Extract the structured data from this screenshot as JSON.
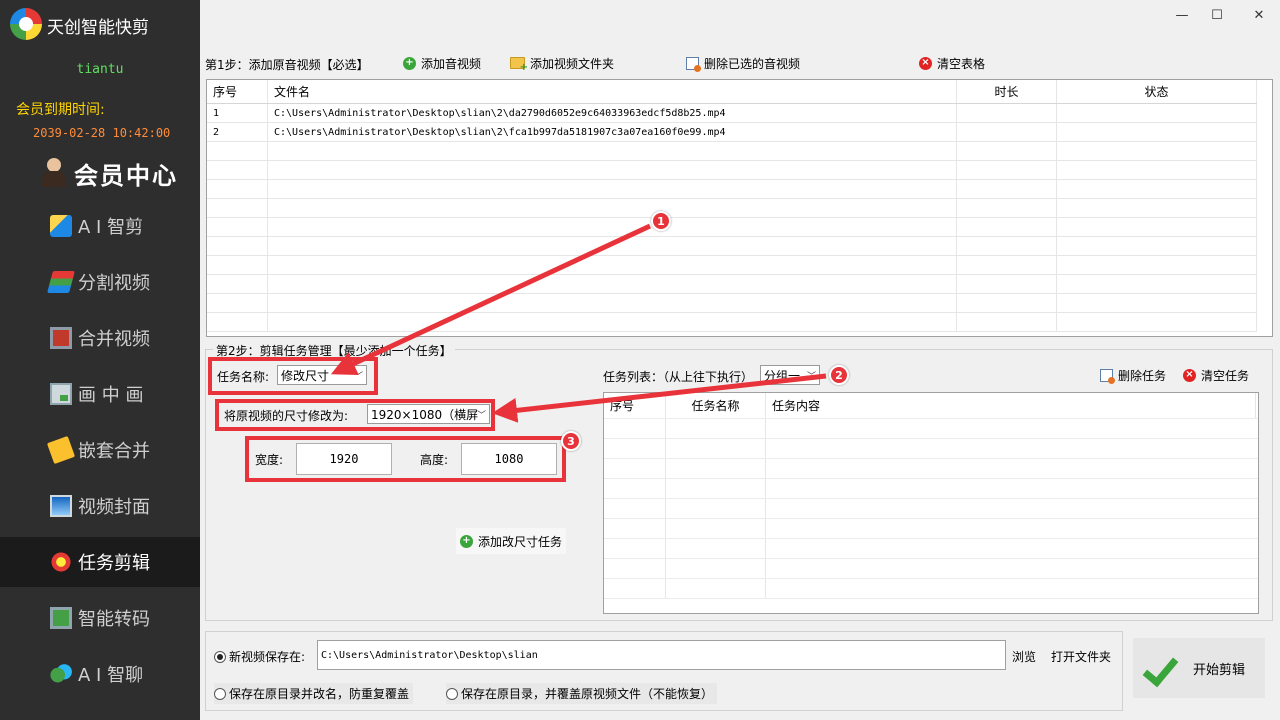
{
  "app": {
    "title": "天创智能快剪",
    "username": "tiantu",
    "member_label": "会员到期时间:",
    "member_date": "2039-02-28 10:42:00",
    "vip_center": "会员中心"
  },
  "nav": [
    {
      "label": "A I 智剪",
      "icon": "ai-clip-icon"
    },
    {
      "label": "分割视频",
      "icon": "split-video-icon"
    },
    {
      "label": "合并视频",
      "icon": "merge-video-icon"
    },
    {
      "label": "画 中 画",
      "icon": "picture-in-picture-icon"
    },
    {
      "label": "嵌套合并",
      "icon": "nest-merge-icon"
    },
    {
      "label": "视频封面",
      "icon": "video-cover-icon"
    },
    {
      "label": "任务剪辑",
      "icon": "task-edit-icon",
      "active": true
    },
    {
      "label": "智能转码",
      "icon": "transcode-icon"
    },
    {
      "label": "A I 智聊",
      "icon": "ai-chat-icon"
    }
  ],
  "window": {
    "minimize": "✕",
    "min": "—",
    "max": "☐",
    "close": "✕"
  },
  "step1": {
    "label": "第1步：添加原音视频【必选】",
    "add_av": "添加音视频",
    "add_folder": "添加视频文件夹",
    "delete_selected": "删除已选的音视频",
    "clear_table": "清空表格",
    "columns": [
      "序号",
      "文件名",
      "时长",
      "状态"
    ],
    "rows": [
      {
        "index": "1",
        "file": "C:\\Users\\Administrator\\Desktop\\slian\\2\\da2790d6052e9c64033963edcf5d8b25.mp4",
        "duration": "",
        "status": ""
      },
      {
        "index": "2",
        "file": "C:\\Users\\Administrator\\Desktop\\slian\\2\\fca1b997da5181907c3a07ea160f0e99.mp4",
        "duration": "",
        "status": ""
      }
    ]
  },
  "step2": {
    "title": "第2步：剪辑任务管理【最少添加一个任务】",
    "task_name_label": "任务名称:",
    "task_name_value": "修改尺寸",
    "resize_label": "将原视频的尺寸修改为:",
    "resize_value": "1920×1080（横屏",
    "width_label": "宽度:",
    "width_value": "1920",
    "height_label": "高度:",
    "height_value": "1080",
    "add_task": "添加改尺寸任务",
    "task_list_label": "任务列表：（从上往下执行）",
    "group_value": "分组一",
    "delete_task": "删除任务",
    "clear_task": "清空任务",
    "task_columns": [
      "序号",
      "任务名称",
      "任务内容"
    ]
  },
  "bottom": {
    "save_label": "新视频保存在:",
    "save_path": "C:\\Users\\Administrator\\Desktop\\slian",
    "browse": "浏览",
    "open_folder": "打开文件夹",
    "option_rename": "保存在原目录并改名，防重复覆盖",
    "option_overwrite": "保存在原目录，并覆盖原视频文件（不能恢复）",
    "start": "开始剪辑"
  },
  "annotations": [
    "1",
    "2",
    "3"
  ],
  "colors": {
    "sidebar": "#2e2e2e",
    "accent_red": "#e8333a",
    "member_yellow": "#ffd400",
    "username_green": "#5fe05f"
  }
}
